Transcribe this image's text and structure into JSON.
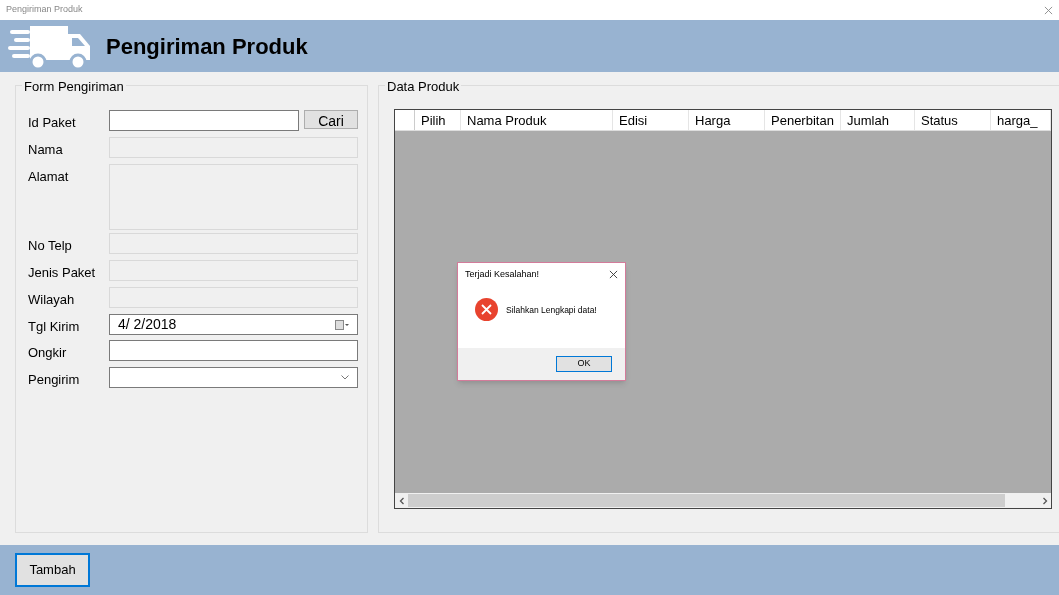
{
  "window": {
    "title": "Pengiriman Produk"
  },
  "header": {
    "title": "Pengiriman Produk"
  },
  "form": {
    "title": "Form Pengiriman",
    "fields": [
      {
        "label": "Id Paket",
        "kind": "text",
        "disabled": false,
        "button": "Cari"
      },
      {
        "label": "Nama",
        "kind": "text",
        "disabled": true
      },
      {
        "label": "Alamat",
        "kind": "textarea",
        "disabled": true
      },
      {
        "label": "No Telp",
        "kind": "text",
        "disabled": true
      },
      {
        "label": "Jenis Paket",
        "kind": "text",
        "disabled": true
      },
      {
        "label": "Wilayah",
        "kind": "text",
        "disabled": true
      },
      {
        "label": "Tgl Kirim",
        "kind": "date",
        "disabled": false,
        "value": "4/  2/2018"
      },
      {
        "label": "Ongkir",
        "kind": "text",
        "disabled": false
      },
      {
        "label": "Pengirim",
        "kind": "combo",
        "disabled": false
      }
    ]
  },
  "products": {
    "title": "Data Produk",
    "columns": [
      "Pilih",
      "Nama Produk",
      "Edisi",
      "Harga",
      "Penerbitan",
      "Jumlah",
      "Status",
      "harga_"
    ]
  },
  "dialog": {
    "title": "Terjadi Kesalahan!",
    "message": "Silahkan Lengkapi data!",
    "button": "OK"
  },
  "footer": {
    "button": "Tambah"
  }
}
